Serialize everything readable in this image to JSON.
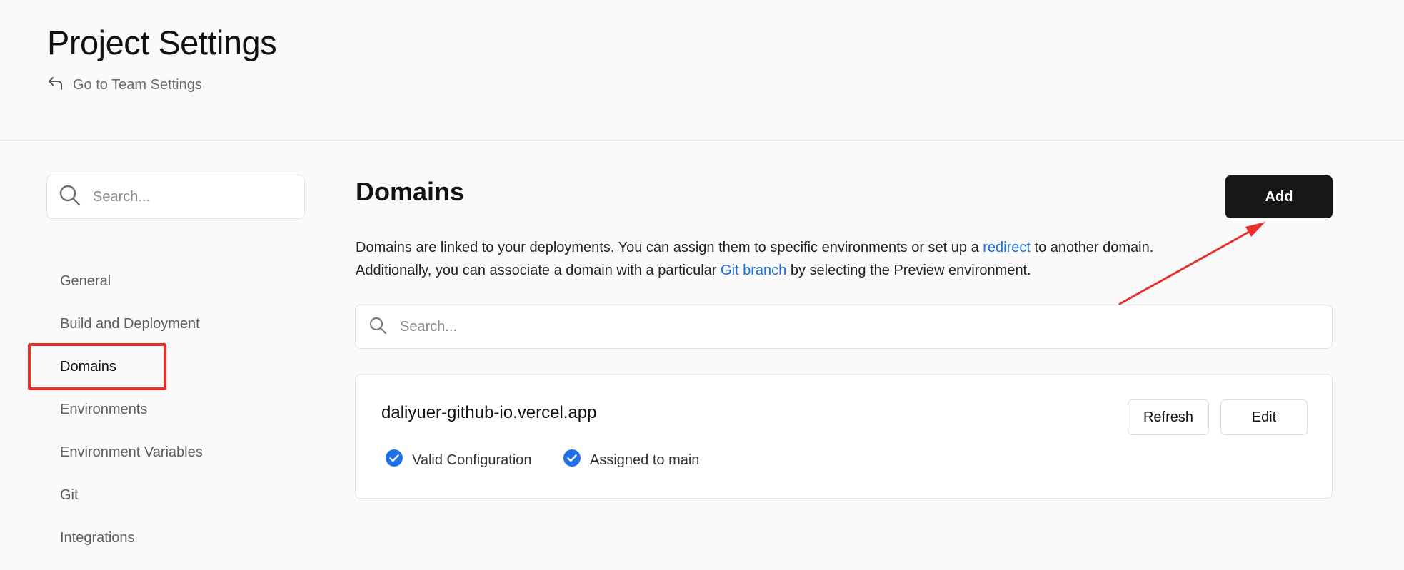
{
  "header": {
    "title": "Project Settings",
    "back_link": "Go to Team Settings"
  },
  "sidebar": {
    "search_placeholder": "Search...",
    "items": [
      {
        "label": "General"
      },
      {
        "label": "Build and Deployment"
      },
      {
        "label": "Domains"
      },
      {
        "label": "Environments"
      },
      {
        "label": "Environment Variables"
      },
      {
        "label": "Git"
      },
      {
        "label": "Integrations"
      }
    ]
  },
  "main": {
    "title": "Domains",
    "add_label": "Add",
    "description": {
      "line1_before": "Domains are linked to your deployments. You can assign them to specific environments or set up a ",
      "line1_link": "redirect",
      "line1_after": " to another domain.",
      "line2_before": "Additionally, you can associate a domain with a particular ",
      "line2_link": "Git branch",
      "line2_after": " by selecting the Preview environment."
    },
    "search_placeholder": "Search...",
    "domain": {
      "name": "daliyuer-github-io.vercel.app",
      "refresh_label": "Refresh",
      "edit_label": "Edit",
      "statuses": [
        "Valid Configuration",
        "Assigned to main"
      ]
    }
  },
  "colors": {
    "accent_link": "#1a6fdb",
    "annotation_red": "#e8302a",
    "button_dark": "#171717",
    "check_blue": "#1f6feb"
  },
  "icons": [
    "arrow-back-icon",
    "search-icon",
    "check-circle-icon"
  ]
}
